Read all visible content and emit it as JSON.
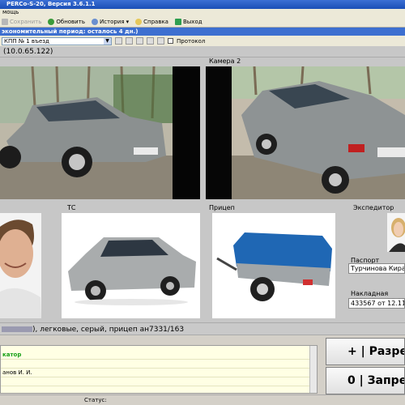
{
  "window": {
    "title": "PERCo-S-20, Версия 3.6.1.1"
  },
  "menu": {
    "text": "мощь"
  },
  "toolbar": {
    "items": [
      {
        "label": "Сохранить",
        "icon": "save-icon",
        "disabled": true
      },
      {
        "label": "Обновить",
        "icon": "refresh-icon"
      },
      {
        "label": "История",
        "icon": "history-icon"
      },
      {
        "label": "Справка",
        "icon": "help-icon"
      },
      {
        "label": "Выход",
        "icon": "exit-icon"
      }
    ]
  },
  "banner": {
    "text": "экономительный период: осталось 4 дн.)"
  },
  "controls": {
    "checkpoint": "КПП № 1 въезд",
    "protocol_label": "Протокол"
  },
  "camera_header": {
    "text": "(10.0.65.122)"
  },
  "cameras": {
    "cam2_label": "Камера 2"
  },
  "panels": {
    "vehicle_label": "ТС",
    "trailer_label": "Прицеп",
    "forwarder_label": "Экспедитор",
    "passport_label": "Паспорт",
    "passport_value": "Турчинова Кира М",
    "waybill_label": "Накладная",
    "waybill_value": "433567 от 12.11.1"
  },
  "status": {
    "text": "), легковые, серый, прицеп ан7331/163"
  },
  "messages": {
    "line1": "катор",
    "line2": "анов И. И."
  },
  "buttons": {
    "allow": "+ | Разре",
    "deny": "0 | Запрет"
  },
  "bottombar": {
    "status_label": "Статус:"
  },
  "colors": {
    "title": "#1b4fb6",
    "banner": "#3d6fd0",
    "message_bg": "#ffffe4",
    "msg_text": "#17a017"
  }
}
